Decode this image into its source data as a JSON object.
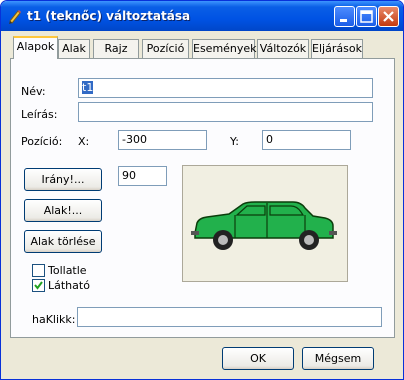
{
  "window": {
    "title": "t1 (teknőc) változtatása"
  },
  "tabs": [
    {
      "label": "Alapok",
      "active": true
    },
    {
      "label": "Alak"
    },
    {
      "label": "Rajz"
    },
    {
      "label": "Pozíció"
    },
    {
      "label": "Események"
    },
    {
      "label": "Változók"
    },
    {
      "label": "Eljárások"
    }
  ],
  "form": {
    "name_label": "Név:",
    "name_value": "t1",
    "desc_label": "Leírás:",
    "desc_value": "",
    "pos_label": "Pozíció:",
    "x_label": "X:",
    "x_value": "-300",
    "y_label": "Y:",
    "y_value": "0",
    "direction_button": "Irány!...",
    "direction_value": "90",
    "shape_button": "Alak!...",
    "delete_shape_button": "Alak törlése",
    "pen_label": "Tollatle",
    "pen_checked": false,
    "visible_label": "Látható",
    "visible_checked": true,
    "onclick_label": "haKlikk:",
    "onclick_value": ""
  },
  "buttons": {
    "ok": "OK",
    "cancel": "Mégsem"
  },
  "colors": {
    "titlebar": "#0053e4",
    "car_body": "#22b14c",
    "panel": "#fcfcfe",
    "dialog": "#ece9d8"
  },
  "icons": {
    "title": "pencil-icon",
    "minimize": "minimize-icon",
    "maximize": "maximize-icon",
    "close": "close-icon"
  }
}
